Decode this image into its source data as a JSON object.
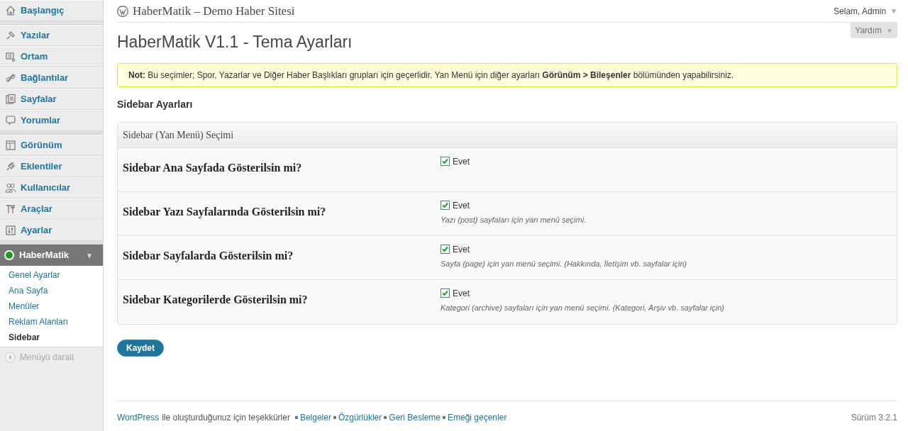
{
  "sidebar": {
    "groups": [
      [
        {
          "label": "Başlangıç"
        }
      ],
      [
        {
          "label": "Yazılar"
        },
        {
          "label": "Ortam"
        },
        {
          "label": "Bağlantılar"
        },
        {
          "label": "Sayfalar"
        },
        {
          "label": "Yorumlar"
        }
      ],
      [
        {
          "label": "Görünüm"
        },
        {
          "label": "Eklentiler"
        },
        {
          "label": "Kullanıcılar"
        },
        {
          "label": "Araçlar"
        },
        {
          "label": "Ayarlar"
        }
      ]
    ],
    "current": {
      "label": "HaberMatik",
      "caret": "▼",
      "submenu": [
        {
          "label": "Genel Ayarlar",
          "selected": false
        },
        {
          "label": "Ana Sayfa",
          "selected": false
        },
        {
          "label": "Menüler",
          "selected": false
        },
        {
          "label": "Reklam Alanları",
          "selected": false
        },
        {
          "label": "Sidebar",
          "selected": true
        }
      ]
    },
    "collapse": "Menüyü daralt"
  },
  "header": {
    "site_title": "HaberMatik – Demo Haber Sitesi",
    "greeting": "Selam, Admin",
    "greeting_caret": "▼",
    "help": "Yardım",
    "help_caret": "▼"
  },
  "page_title": "HaberMatik V1.1 - Tema Ayarları",
  "notice": "**Not:** Bu seçimler; Spor, Yazarlar ve Diğer Haber Başlıkları grupları için geçerlidir. Yan Menü için diğer ayarları **Görünüm > Bileşenler** bölümünden yapabilirsiniz.",
  "section_title": "Sidebar Ayarları",
  "panel": {
    "title": "Sidebar (Yan Menü) Seçimi",
    "rows": [
      {
        "label": "Sidebar Ana Sayfada Gösterilsin mi?",
        "checked": true,
        "option": "Evet"
      },
      {
        "label": "Sidebar Yazı Sayfalarında Gösterilsin mi?",
        "checked": true,
        "option": "Evet",
        "description": "Yazı (post) sayfaları için yan menü seçimi."
      },
      {
        "label": "Sidebar Sayfalarda Gösterilsin mi?",
        "checked": true,
        "option": "Evet",
        "description": "Sayfa (page) için yan menü seçimi. (Hakkında, İletişim vb. sayfalar için)"
      },
      {
        "label": "Sidebar Kategorilerde Gösterilsin mi?",
        "checked": true,
        "option": "Evet",
        "description": "Kategori (archive) sayfaları için yan menü seçimi. (Kategori, Arşiv vb. sayfalar için)"
      }
    ]
  },
  "save_button": "Kaydet",
  "footer": {
    "parts": [
      {
        "kind": "link",
        "text": "WordPress"
      },
      {
        "kind": "text",
        "text": "ile oluşturduğunuz için teşekkürler"
      },
      {
        "kind": "link",
        "text": "Belgeler"
      },
      {
        "kind": "link",
        "text": "Özgürlükler"
      },
      {
        "kind": "link",
        "text": "Geri Besleme"
      },
      {
        "kind": "link",
        "text": "Emeği geçenler"
      }
    ],
    "version": "Sürüm 3.2.1"
  }
}
